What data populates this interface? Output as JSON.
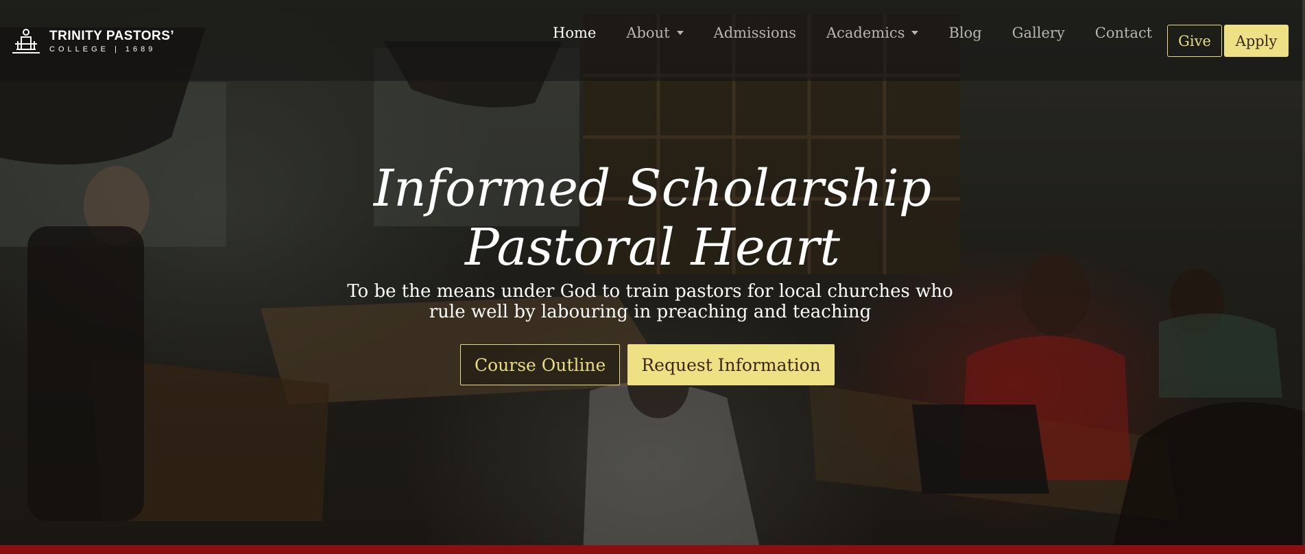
{
  "brand": {
    "name_line1": "TRINITY PASTORS’",
    "name_line2": "COLLEGE | 1689",
    "logo_icon": "college-building-icon"
  },
  "nav": {
    "items": [
      {
        "label": "Home",
        "active": true,
        "dropdown": false
      },
      {
        "label": "About",
        "active": false,
        "dropdown": true
      },
      {
        "label": "Admissions",
        "active": false,
        "dropdown": false
      },
      {
        "label": "Academics",
        "active": false,
        "dropdown": true
      },
      {
        "label": "Blog",
        "active": false,
        "dropdown": false
      },
      {
        "label": "Gallery",
        "active": false,
        "dropdown": false
      },
      {
        "label": "Contact",
        "active": false,
        "dropdown": false
      }
    ],
    "give_label": "Give",
    "apply_label": "Apply"
  },
  "hero": {
    "headline_line1": "Informed Scholarship",
    "headline_line2": "Pastoral Heart",
    "tagline": "To be the means under God to train pastors for local churches who rule well by labouring in preaching and teaching",
    "cta_primary": "Course Outline",
    "cta_secondary": "Request Information"
  },
  "colors": {
    "accent_gold": "#ede085",
    "footer_red": "#8c0f0f",
    "nav_text": "#b9b6ae"
  }
}
